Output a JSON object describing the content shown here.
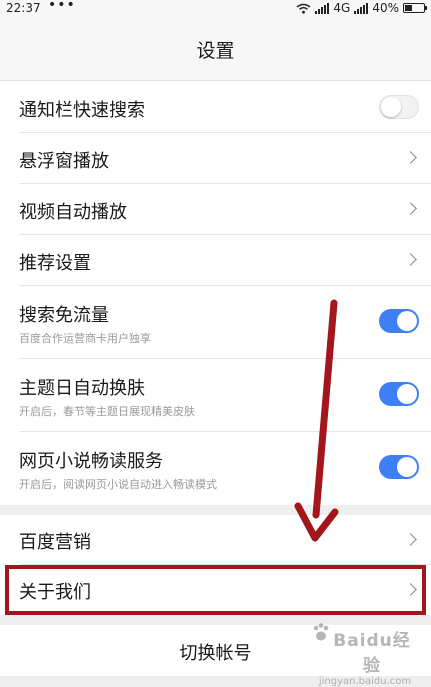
{
  "status_bar": {
    "time": "22:37",
    "dots": "•••",
    "network": "4G",
    "battery": "40%",
    "icons": [
      "wifi-icon",
      "signal-icon",
      "signal-icon",
      "battery-icon"
    ]
  },
  "header": {
    "title": "设置"
  },
  "settings": [
    {
      "id": "notif-search",
      "title": "通知栏快速搜索",
      "control": "toggle",
      "enabled": false
    },
    {
      "id": "float-window",
      "title": "悬浮窗播放",
      "control": "chevron"
    },
    {
      "id": "video-autoplay",
      "title": "视频自动播放",
      "control": "chevron"
    },
    {
      "id": "recommend",
      "title": "推荐设置",
      "control": "chevron"
    },
    {
      "id": "free-traffic",
      "title": "搜索免流量",
      "subtitle": "百度合作运营商卡用户独享",
      "control": "toggle",
      "enabled": true
    },
    {
      "id": "theme-day",
      "title": "主题日自动换肤",
      "subtitle": "开启后，春节等主题日展现精美皮肤",
      "control": "toggle",
      "enabled": true
    },
    {
      "id": "novel-reader",
      "title": "网页小说畅读服务",
      "subtitle": "开启后，阅读网页小说自动进入畅读模式",
      "control": "toggle",
      "enabled": true
    }
  ],
  "section2": [
    {
      "id": "baidu-marketing",
      "title": "百度营销",
      "control": "chevron"
    },
    {
      "id": "about-us",
      "title": "关于我们",
      "control": "chevron"
    }
  ],
  "switch_account": "切换帐号",
  "watermark": {
    "logo": "Baidu经验",
    "url": "jingyan.baidu.com"
  },
  "colors": {
    "accent": "#3d7ff5",
    "annotation": "#a3161b",
    "background": "#efefef"
  }
}
